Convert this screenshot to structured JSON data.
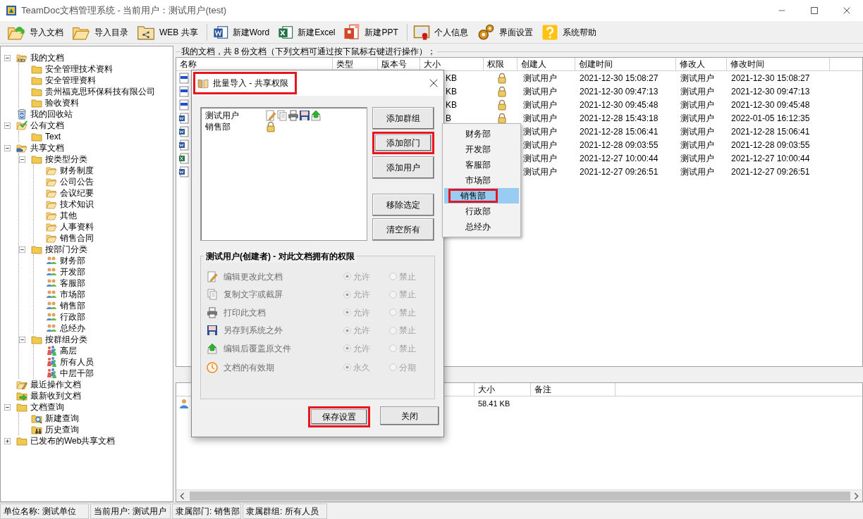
{
  "window": {
    "title": "TeamDoc文档管理系统 - 当前用户：测试用户(test)"
  },
  "toolbar": [
    [
      {
        "kind": "import-doc",
        "label": "导入文档"
      },
      {
        "kind": "import-dir",
        "label": "导入目录"
      },
      {
        "kind": "web-share",
        "label": "WEB 共享"
      }
    ],
    [
      {
        "kind": "word",
        "label": "新建Word"
      },
      {
        "kind": "excel",
        "label": "新建Excel"
      },
      {
        "kind": "ppt",
        "label": "新建PPT"
      }
    ],
    [
      {
        "kind": "profile",
        "label": "个人信息"
      },
      {
        "kind": "settings",
        "label": "界面设置"
      },
      {
        "kind": "help",
        "label": "系统帮助"
      }
    ]
  ],
  "tree": [
    {
      "label": "我的文档",
      "kind": "linked-folder",
      "expanded": true,
      "children": [
        {
          "label": "安全管理技术资料",
          "kind": "folder"
        },
        {
          "label": "安全管理资料",
          "kind": "folder"
        },
        {
          "label": "贵州福克思环保科技有限公司",
          "kind": "folder"
        },
        {
          "label": "验收资料",
          "kind": "folder"
        }
      ]
    },
    {
      "label": "我的回收站",
      "kind": "recycle"
    },
    {
      "label": "公有文档",
      "kind": "checked-folder",
      "expanded": true,
      "children": [
        {
          "label": "Text",
          "kind": "folder"
        }
      ]
    },
    {
      "label": "共享文档",
      "kind": "shared-folder",
      "expanded": true,
      "children": [
        {
          "label": "按类型分类",
          "kind": "folder",
          "expanded": true,
          "children": [
            {
              "label": "财务制度",
              "kind": "open-folder"
            },
            {
              "label": "公司公告",
              "kind": "open-folder"
            },
            {
              "label": "会议纪要",
              "kind": "open-folder"
            },
            {
              "label": "技术知识",
              "kind": "open-folder"
            },
            {
              "label": "其他",
              "kind": "open-folder"
            },
            {
              "label": "人事资料",
              "kind": "open-folder"
            },
            {
              "label": "销售合同",
              "kind": "open-folder"
            }
          ]
        },
        {
          "label": "按部门分类",
          "kind": "folder",
          "expanded": true,
          "children": [
            {
              "label": "财务部",
              "kind": "group"
            },
            {
              "label": "开发部",
              "kind": "group"
            },
            {
              "label": "客服部",
              "kind": "group"
            },
            {
              "label": "市场部",
              "kind": "group"
            },
            {
              "label": "销售部",
              "kind": "group"
            },
            {
              "label": "行政部",
              "kind": "group"
            },
            {
              "label": "总经办",
              "kind": "group"
            }
          ]
        },
        {
          "label": "按群组分类",
          "kind": "folder",
          "expanded": true,
          "children": [
            {
              "label": "高层",
              "kind": "people"
            },
            {
              "label": "所有人员",
              "kind": "people"
            },
            {
              "label": "中层干部",
              "kind": "people"
            }
          ]
        }
      ]
    },
    {
      "label": "最近操作文档",
      "kind": "recent"
    },
    {
      "label": "最新收到文档",
      "kind": "inbox"
    },
    {
      "label": "文档查询",
      "kind": "folder",
      "expanded": true,
      "children": [
        {
          "label": "新建查询",
          "kind": "search-folder"
        },
        {
          "label": "历史查询",
          "kind": "history"
        }
      ]
    },
    {
      "label": "已发布的Web共享文档",
      "kind": "folder",
      "expanded": false
    }
  ],
  "documents": {
    "caption": "我的文档，共 8 份文档（下列文档可通过按下鼠标右键进行操作）；",
    "columns": [
      "名称",
      "类型",
      "版本号",
      "大小",
      "权限",
      "创建人",
      "创建时间",
      "修改人",
      "修改时间"
    ],
    "rows": [
      {
        "kind": "jpg",
        "size": "KB",
        "locked": true,
        "creator": "测试用户",
        "created": "2021-12-30 15:08:27",
        "modifier": "测试用户",
        "modified": "2021-12-30 15:08:27"
      },
      {
        "kind": "jpg",
        "size": "KB",
        "locked": true,
        "creator": "测试用户",
        "created": "2021-12-30 09:47:13",
        "modifier": "测试用户",
        "modified": "2021-12-30 09:47:13"
      },
      {
        "kind": "jpg",
        "size": "KB",
        "locked": true,
        "creator": "测试用户",
        "created": "2021-12-30 09:45:48",
        "modifier": "测试用户",
        "modified": "2021-12-30 09:45:48"
      },
      {
        "kind": "word",
        "size": "B",
        "locked": true,
        "creator": "测试用户",
        "created": "2021-12-28 15:43:18",
        "modifier": "测试用户",
        "modified": "2022-01-05 16:12:35"
      },
      {
        "kind": "word",
        "creator": "测试用户",
        "created": "2021-12-28 15:06:41",
        "modifier": "测试用户",
        "modified": "2021-12-28 15:06:41"
      },
      {
        "kind": "word",
        "creator": "测试用户",
        "created": "2021-12-28 09:03:55",
        "modifier": "测试用户",
        "modified": "2021-12-28 09:03:55"
      },
      {
        "kind": "excel",
        "creator": "测试用户",
        "created": "2021-12-27 10:00:44",
        "modifier": "测试用户",
        "modified": "2021-12-27 10:00:44"
      },
      {
        "kind": "word",
        "creator": "测试用户",
        "created": "2021-12-27 09:26:51",
        "modifier": "测试用户",
        "modified": "2021-12-27 09:26:51"
      }
    ]
  },
  "details": {
    "columns": [
      "大小",
      "备注"
    ],
    "rows": [
      {
        "kind": "user",
        "size": "58.41 KB"
      }
    ]
  },
  "dialog": {
    "title": "批量导入 - 共享权限",
    "title_highlighted": true,
    "entries": [
      {
        "name": "测试用户",
        "perms": [
          {
            "kind": "edit"
          },
          {
            "kind": "copy"
          },
          {
            "kind": "print"
          },
          {
            "kind": "save"
          },
          {
            "kind": "upload"
          }
        ]
      },
      {
        "name": "销售部",
        "perms": [
          {
            "kind": "lock"
          }
        ]
      }
    ],
    "buttons_top": [
      {
        "label": "添加群组",
        "highlighted": false
      },
      {
        "label": "添加部门",
        "highlighted": true
      },
      {
        "label": "添加用户",
        "highlighted": false
      }
    ],
    "buttons_bottom": [
      {
        "label": "移除选定",
        "highlighted": false
      },
      {
        "label": "清空所有",
        "highlighted": false
      }
    ],
    "permissions": {
      "title": "测试用户(创建者) - 对此文档拥有的权限",
      "disabled": true,
      "rows": [
        {
          "kind": "edit",
          "label": "编辑更改此文档",
          "options": [
            {
              "label": "允许",
              "selected": true
            },
            {
              "label": "禁止",
              "selected": false
            }
          ]
        },
        {
          "kind": "copy",
          "label": "复制文字或截屏",
          "options": [
            {
              "label": "允许",
              "selected": true
            },
            {
              "label": "禁止",
              "selected": false
            }
          ]
        },
        {
          "kind": "print",
          "label": "打印此文档",
          "options": [
            {
              "label": "允许",
              "selected": true
            },
            {
              "label": "禁止",
              "selected": false
            }
          ]
        },
        {
          "kind": "save",
          "label": "另存到系统之外",
          "options": [
            {
              "label": "允许",
              "selected": true
            },
            {
              "label": "禁止",
              "selected": false
            }
          ]
        },
        {
          "kind": "upload",
          "label": "编辑后覆盖原文件",
          "options": [
            {
              "label": "允许",
              "selected": true
            },
            {
              "label": "禁止",
              "selected": false
            }
          ]
        },
        {
          "kind": "clock",
          "label": "文档的有效期",
          "options": [
            {
              "label": "永久",
              "selected": true
            },
            {
              "label": "分期",
              "selected": false
            }
          ]
        }
      ]
    },
    "footer_buttons": [
      {
        "label": "保存设置",
        "highlighted": true
      },
      {
        "label": "关闭",
        "highlighted": false
      }
    ]
  },
  "department_menu": [
    {
      "label": "财务部",
      "selected": false
    },
    {
      "label": "开发部",
      "selected": false
    },
    {
      "label": "客服部",
      "selected": false
    },
    {
      "label": "市场部",
      "selected": false
    },
    {
      "label": "销售部",
      "selected": true,
      "highlighted": true
    },
    {
      "label": "行政部",
      "selected": false
    },
    {
      "label": "总经办",
      "selected": false
    }
  ],
  "status_bar": [
    "单位名称: 测试单位",
    "当前用户: 测试用户",
    "隶属部门: 销售部",
    "隶属群组: 所有人员"
  ]
}
